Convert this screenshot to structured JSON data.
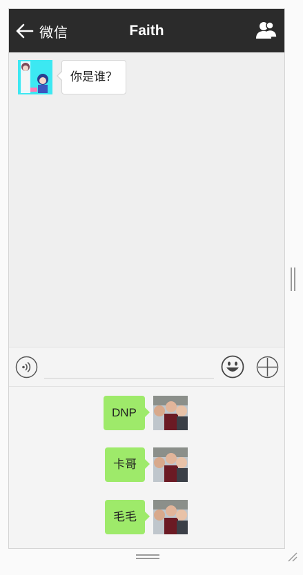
{
  "header": {
    "back_label": "微信",
    "title": "Faith",
    "back_icon": "arrow-left-icon",
    "contacts_icon": "people-icon"
  },
  "chat": {
    "incoming": [
      {
        "text": "你是谁？",
        "avatar": "anime-avatar"
      }
    ]
  },
  "input": {
    "placeholder": "",
    "value": "",
    "voice_icon": "voice-icon",
    "emoji_icon": "emoji-icon",
    "plus_icon": "plus-icon"
  },
  "quick_replies": [
    {
      "label": "DNP"
    },
    {
      "label": "卡哥"
    },
    {
      "label": "毛毛"
    }
  ],
  "colors": {
    "titlebar": "#2b2b2b",
    "outgoing_bubble": "#9eea6a",
    "chat_background": "#efefef"
  }
}
